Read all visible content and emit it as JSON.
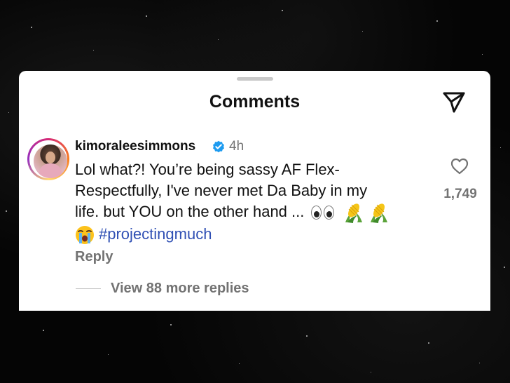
{
  "sheet": {
    "title": "Comments"
  },
  "comment": {
    "username": "kimoraleesimmons",
    "timestamp": "4h",
    "lines": [
      "Lol what?! You’re being sassy AF Flex-",
      "Respectfully, I've never met Da Baby in my",
      "life. but YOU on the other hand ..."
    ],
    "hashtag": "#projectingmuch",
    "emojis": [
      "eyes-emoji",
      "corn-emoji",
      "corn-emoji",
      "loudly-crying-face-emoji"
    ],
    "like_count": "1,749",
    "reply_label": "Reply",
    "view_replies_label": "View 88 more replies"
  },
  "colors": {
    "background": "#060606",
    "card": "#ffffff",
    "hashtag": "#3050b4",
    "secondary_text": "#737373",
    "verified": "#1d9bf0"
  },
  "icons": {
    "share": "paper-plane-icon",
    "like": "heart-outline-icon",
    "verified": "verified-badge-icon"
  }
}
